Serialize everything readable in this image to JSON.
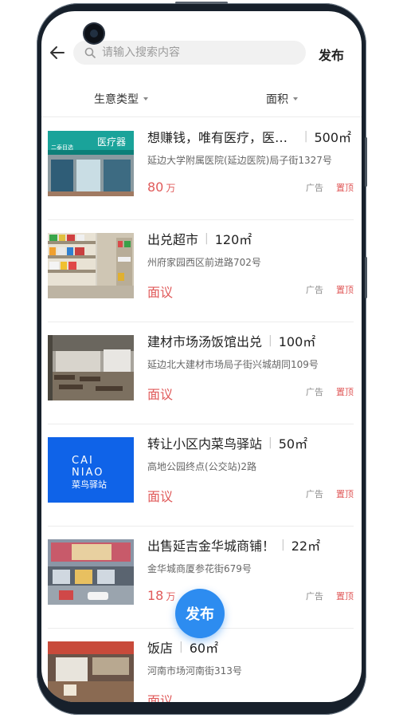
{
  "header": {
    "search_placeholder": "请输入搜索内容",
    "publish_label": "发布"
  },
  "filters": {
    "business_type": "生意类型",
    "area": "面积"
  },
  "listings": [
    {
      "title": "想赚钱，唯有医疗，医疗店铺出兑",
      "area": "500㎡",
      "address": "延边大学附属医院(延边医院)局子街1327号",
      "price": "80",
      "price_unit": "万",
      "ad": "广告",
      "top": "置顶"
    },
    {
      "title": "出兑超市",
      "area": "120㎡",
      "address": "州府家园西区前进路702号",
      "price": "面议",
      "price_unit": "",
      "ad": "广告",
      "top": "置顶"
    },
    {
      "title": "建材市场汤饭馆出兑",
      "area": "100㎡",
      "address": "延边北大建材市场局子街兴城胡同109号",
      "price": "面议",
      "price_unit": "",
      "ad": "广告",
      "top": "置顶"
    },
    {
      "title": "转让小区内菜鸟驿站",
      "area": "50㎡",
      "address": "高地公园终点(公交站)2路",
      "price": "面议",
      "price_unit": "",
      "ad": "广告",
      "top": "置顶"
    },
    {
      "title": "出售延吉金华城商铺！",
      "area": "22㎡",
      "address": "金华城商厦参花街679号",
      "price": "18",
      "price_unit": "万",
      "ad": "广告",
      "top": "置顶"
    },
    {
      "title": "饭店",
      "area": "60㎡",
      "address": "河南市场河南街313号",
      "price": "面议",
      "price_unit": "",
      "ad": "",
      "top": ""
    }
  ],
  "thumb_texts": {
    "clinic_sign": "医疗器",
    "clinic_sub": "二泰目选",
    "cainiao_en1": "CAI",
    "cainiao_en2": "NIAO",
    "cainiao_cn": "菜鸟驿站"
  },
  "fab": {
    "label": "发布"
  },
  "colors": {
    "accent": "#2d8cf0",
    "price": "#e05a5a",
    "cainiao_bg": "#0f63e8"
  }
}
